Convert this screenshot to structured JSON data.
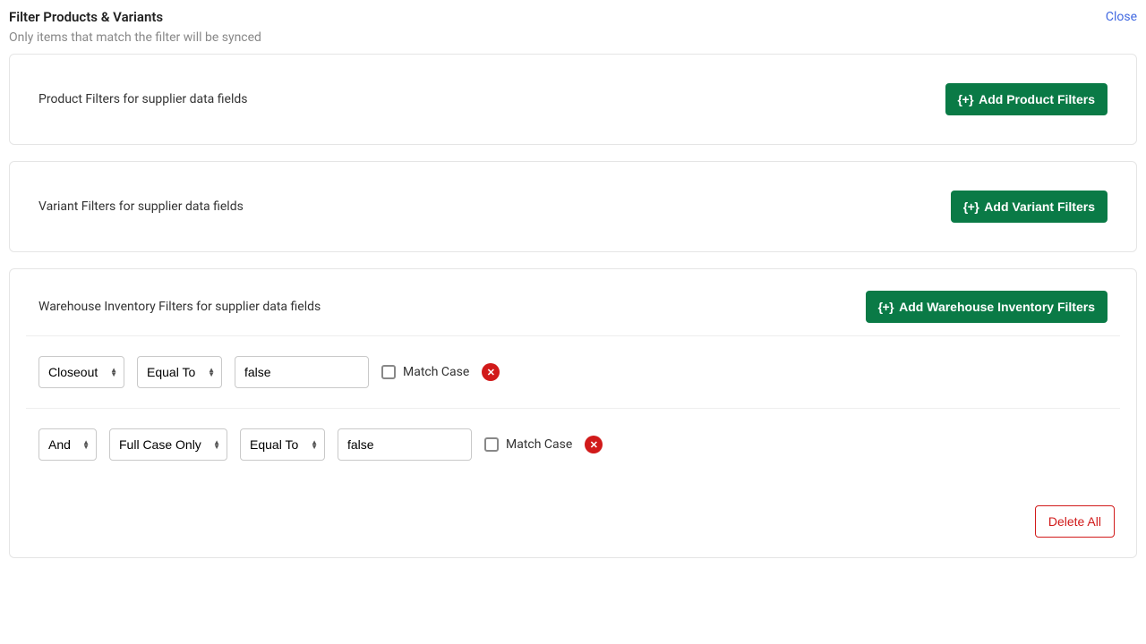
{
  "header": {
    "title": "Filter Products & Variants",
    "close": "Close",
    "subtitle": "Only items that match the filter will be synced"
  },
  "addPrefix": "{+}",
  "sections": {
    "product": {
      "label": "Product Filters for supplier data fields",
      "addBtn": "Add Product Filters"
    },
    "variant": {
      "label": "Variant Filters for supplier data fields",
      "addBtn": "Add Variant Filters"
    },
    "warehouse": {
      "label": "Warehouse Inventory Filters for supplier data fields",
      "addBtn": "Add Warehouse Inventory Filters"
    }
  },
  "rows": [
    {
      "field": "Closeout",
      "op": "Equal To",
      "value": "false",
      "matchCaseLabel": "Match Case"
    },
    {
      "logic": "And",
      "field": "Full Case Only",
      "op": "Equal To",
      "value": "false",
      "matchCaseLabel": "Match Case"
    }
  ],
  "deleteAll": "Delete All"
}
